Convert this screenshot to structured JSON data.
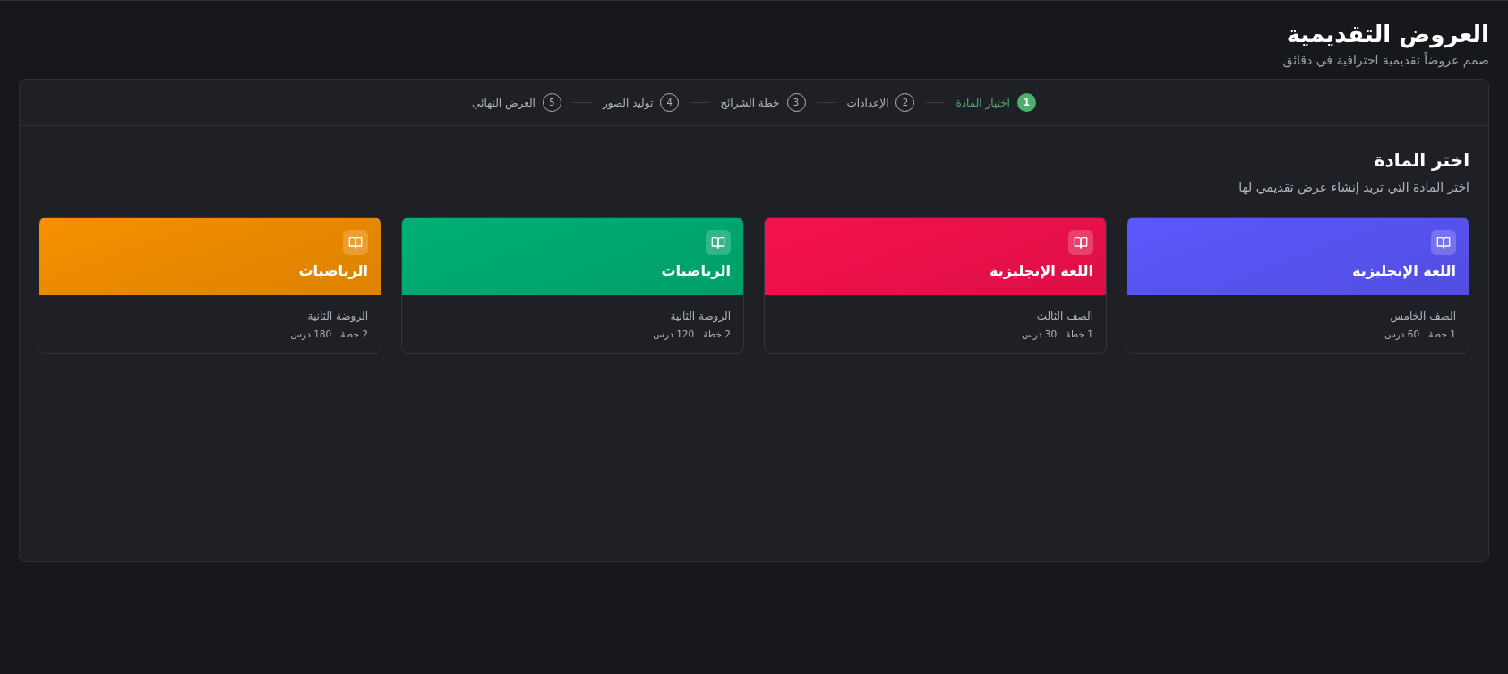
{
  "header": {
    "title": "العروض التقديمية",
    "subtitle": "صمم عروضاً تقديمية احترافية في دقائق"
  },
  "steps": [
    {
      "number": "1",
      "label": "اختيار المادة",
      "selected": true
    },
    {
      "number": "2",
      "label": "الإعدادات",
      "selected": false
    },
    {
      "number": "3",
      "label": "خطة الشرائح",
      "selected": false
    },
    {
      "number": "4",
      "label": "توليد الصور",
      "selected": false
    },
    {
      "number": "5",
      "label": "العرض النهائي",
      "selected": false
    }
  ],
  "section": {
    "title": "اختر المادة",
    "subtitle": "اختر المادة التي تريد إنشاء عرض تقديمي لها"
  },
  "subjects": [
    {
      "name": "اللغة الإنجليزية",
      "color": "#5b57fb",
      "grade": "الصف الخامس",
      "plans": "1 خطة",
      "lessons": "60 درس"
    },
    {
      "name": "اللغة الإنجليزية",
      "color": "#f5114e",
      "grade": "الصف الثالث",
      "plans": "1 خطة",
      "lessons": "30 درس"
    },
    {
      "name": "الرياضيات",
      "color": "#00b074",
      "grade": "الروضة الثانية",
      "plans": "2 خطة",
      "lessons": "120 درس"
    },
    {
      "name": "الرياضيات",
      "color": "#f59000",
      "grade": "الروضة الثانية",
      "plans": "2 خطة",
      "lessons": "180 درس"
    }
  ]
}
